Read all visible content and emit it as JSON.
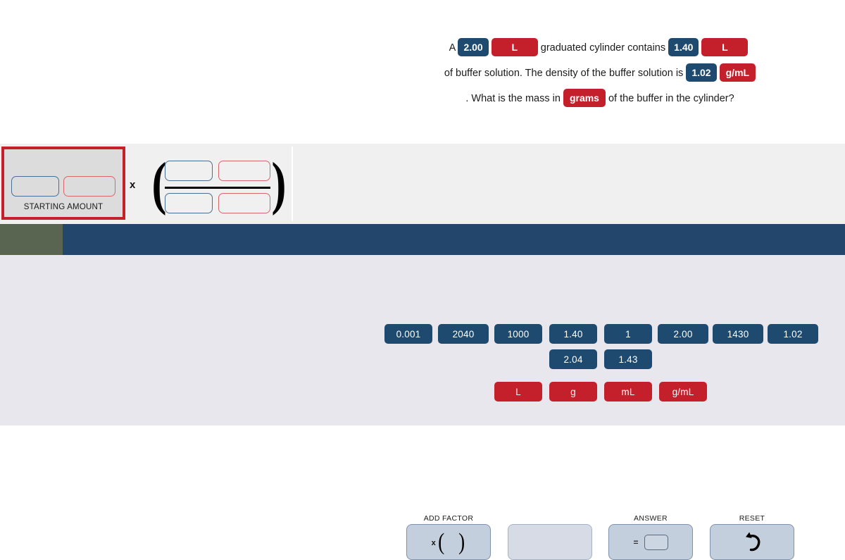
{
  "problem": {
    "line1_a": "A ",
    "chip_volume_value": "2.00",
    "chip_volume_unit": "L",
    "line1_b": " graduated cylinder contains ",
    "chip_amount_value": "1.40",
    "chip_amount_unit": "L",
    "line1_c": " of buffer solution. The density",
    "line2_a": "of the buffer solution is ",
    "chip_density_value": "1.02",
    "chip_density_unit": "g/mL",
    "line2_b": " . What is the mass in ",
    "chip_target_unit": "grams",
    "line2_c": " of the buffer in the",
    "line3": "cylinder?"
  },
  "work": {
    "starting_amount_label": "STARTING AMOUNT",
    "times_symbol": "x",
    "starting_value": "",
    "starting_unit": "",
    "numerator_value": "",
    "numerator_unit": "",
    "denominator_value": "",
    "denominator_unit": "",
    "paren_left": "(",
    "paren_right": ")"
  },
  "toolbar": {
    "add_factor_caption": "ADD FACTOR",
    "add_factor_x": "x",
    "add_factor_paren_left": "(",
    "add_factor_paren_right": ")",
    "answer_caption": "ANSWER",
    "answer_equals": "=",
    "answer_value": "",
    "reset_caption": "RESET",
    "reset_icon_glyph": "↺",
    "empty_slot_value": ""
  },
  "tiles": {
    "numbers_row1": [
      "0.001",
      "2040",
      "1000",
      "1.40",
      "1",
      "2.00",
      "1430",
      "1.02"
    ],
    "numbers_row2": [
      "2.04",
      "1.43"
    ],
    "units": [
      "L",
      "g",
      "mL",
      "g/mL"
    ]
  },
  "colors": {
    "chip_number": "#1d4a6e",
    "chip_unit": "#c4202c",
    "band_navy": "#23476c",
    "band_olive": "#5a6551",
    "tray_bg": "#e8e7ee",
    "work_bg": "#f0f0f0",
    "starting_border": "#c4202c",
    "tool_button": "#c4cfdd"
  }
}
